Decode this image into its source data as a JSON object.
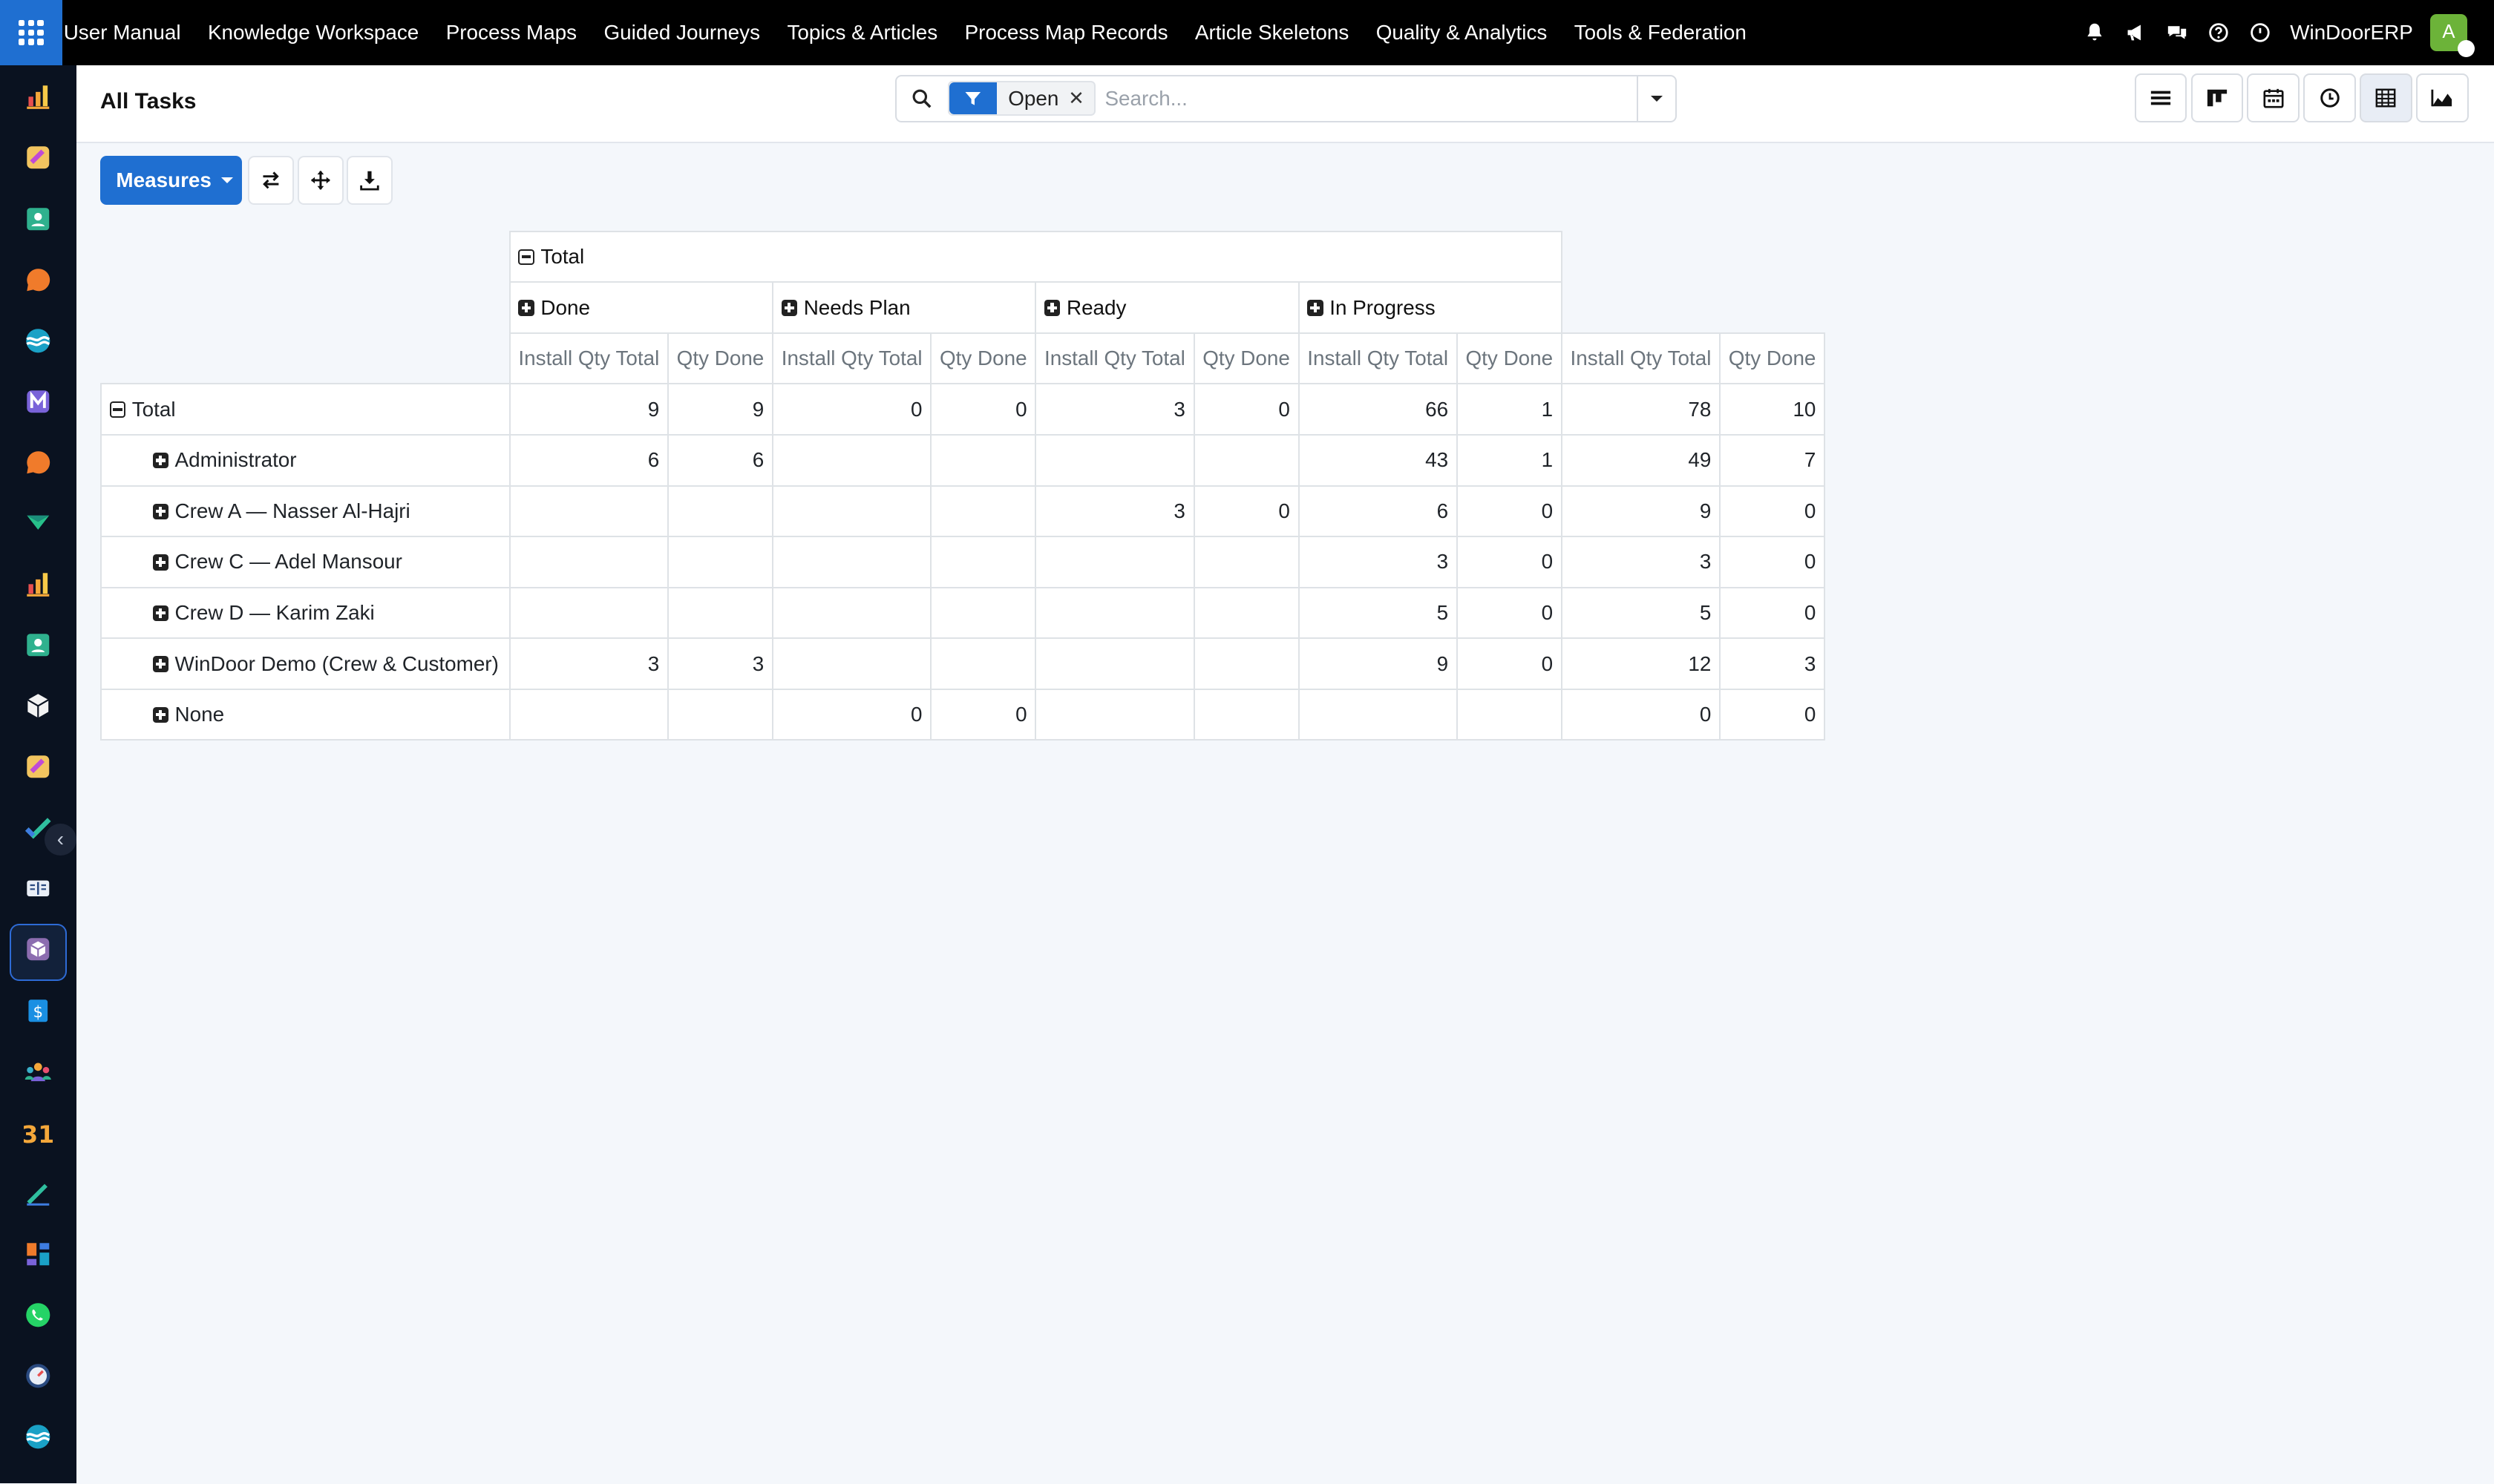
{
  "topnav": {
    "menu": [
      "User Manual",
      "Knowledge Workspace",
      "Process Maps",
      "Guided Journeys",
      "Topics & Articles",
      "Process Map Records",
      "Article Skeletons",
      "Quality & Analytics",
      "Tools & Federation"
    ],
    "company": "WinDoorERP",
    "avatar_initial": "A"
  },
  "control_panel": {
    "title": "All Tasks",
    "facet_value": "Open",
    "search_placeholder": "Search..."
  },
  "toolbar": {
    "measures_label": "Measures"
  },
  "pivot": {
    "col_total_label": "Total",
    "col_groups": [
      "Done",
      "Needs Plan",
      "Ready",
      "In Progress"
    ],
    "measures": [
      "Install Qty Total",
      "Qty Done"
    ],
    "rows": [
      {
        "label": "Total",
        "expanded": true,
        "values": [
          "9",
          "9",
          "0",
          "0",
          "3",
          "0",
          "66",
          "1",
          "78",
          "10"
        ]
      },
      {
        "label": "Administrator",
        "values": [
          "6",
          "6",
          "",
          "",
          "",
          "",
          "43",
          "1",
          "49",
          "7"
        ]
      },
      {
        "label": "Crew A — Nasser Al-Hajri",
        "values": [
          "",
          "",
          "",
          "",
          "3",
          "0",
          "6",
          "0",
          "9",
          "0"
        ]
      },
      {
        "label": "Crew C — Adel Mansour",
        "values": [
          "",
          "",
          "",
          "",
          "",
          "",
          "3",
          "0",
          "3",
          "0"
        ]
      },
      {
        "label": "Crew D — Karim Zaki",
        "values": [
          "",
          "",
          "",
          "",
          "",
          "",
          "5",
          "0",
          "5",
          "0"
        ]
      },
      {
        "label": "WinDoor Demo (Crew & Customer)",
        "values": [
          "3",
          "3",
          "",
          "",
          "",
          "",
          "9",
          "0",
          "12",
          "3"
        ]
      },
      {
        "label": "None",
        "values": [
          "",
          "",
          "0",
          "0",
          "",
          "",
          "",
          "",
          "0",
          "0"
        ]
      }
    ]
  },
  "colors": {
    "accent": "#1f6fd1",
    "topbar": "#000000",
    "sidebar": "#0a1220",
    "avatar": "#6cb339"
  },
  "icons": {
    "sidebar": [
      "bar-chart-icon",
      "puzzle-icon",
      "contact-card-icon",
      "chat-bubble-icon",
      "globe-wave-icon",
      "m-app-icon",
      "chat-bubble-icon",
      "check-flag-icon",
      "bar-chart-icon",
      "contact-card-icon",
      "cube-icon",
      "puzzle-icon",
      "checkmark-icon",
      "book-icon",
      "box-icon",
      "dollar-doc-icon",
      "people-icon",
      "calendar-31-icon",
      "pen-icon",
      "dashboard-icon",
      "whatsapp-icon",
      "gauge-icon",
      "globe-wave-icon"
    ]
  }
}
